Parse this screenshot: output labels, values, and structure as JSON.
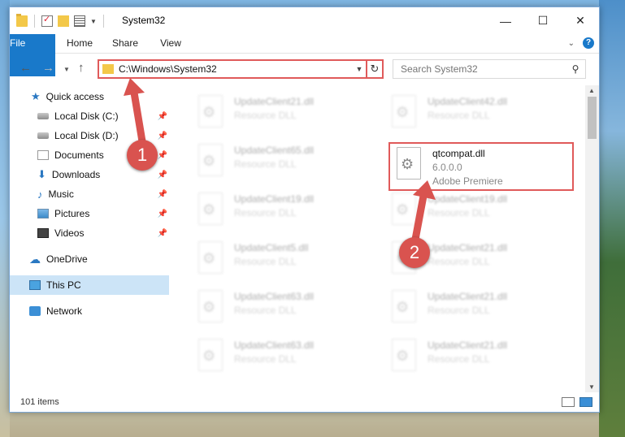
{
  "window": {
    "title": "System32",
    "controls": {
      "minimize": "—",
      "maximize": "☐",
      "close": "✕"
    }
  },
  "ribbon": {
    "tabs": [
      "File",
      "Home",
      "Share",
      "View"
    ]
  },
  "address": {
    "path": "C:\\Windows\\System32",
    "search_placeholder": "Search System32"
  },
  "nav": {
    "items": [
      {
        "label": "Quick access",
        "icon": "star-icon"
      },
      {
        "label": "Local Disk (C:)",
        "icon": "drive-icon",
        "pinned": true
      },
      {
        "label": "Local Disk (D:)",
        "icon": "drive-icon",
        "pinned": true
      },
      {
        "label": "Documents",
        "icon": "documents-icon",
        "pinned": true
      },
      {
        "label": "Downloads",
        "icon": "download-icon",
        "pinned": true
      },
      {
        "label": "Music",
        "icon": "music-icon",
        "pinned": true
      },
      {
        "label": "Pictures",
        "icon": "pictures-icon",
        "pinned": true
      },
      {
        "label": "Videos",
        "icon": "videos-icon",
        "pinned": true
      },
      {
        "label": "OneDrive",
        "icon": "cloud-icon"
      },
      {
        "label": "This PC",
        "icon": "pc-icon",
        "selected": true
      },
      {
        "label": "Network",
        "icon": "network-icon"
      }
    ]
  },
  "files": {
    "highlighted": {
      "name": "qtcompat.dll",
      "version": "6.0.0.0",
      "company": "Adobe Premiere"
    },
    "background": [
      {
        "name": "UpdateClient21.dll",
        "sub": "Resource DLL"
      },
      {
        "name": "UpdateClient42.dll",
        "sub": "Resource DLL"
      },
      {
        "name": "UpdateClient65.dll",
        "sub": "Resource DLL"
      },
      {
        "name": "UpdateClient19.dll",
        "sub": "Resource DLL"
      },
      {
        "name": "UpdateClient19.dll",
        "sub": "Resource DLL"
      },
      {
        "name": "UpdateClient5.dll",
        "sub": "Resource DLL"
      },
      {
        "name": "UpdateClient21.dll",
        "sub": "Resource DLL"
      },
      {
        "name": "UpdateClient63.dll",
        "sub": "Resource DLL"
      },
      {
        "name": "UpdateClient21.dll",
        "sub": "Resource DLL"
      },
      {
        "name": "UpdateClient63.dll",
        "sub": "Resource DLL"
      },
      {
        "name": "UpdateClient21.dll",
        "sub": "Resource DLL"
      }
    ]
  },
  "status": {
    "item_count": "101 items"
  },
  "annotations": {
    "step1": "1",
    "step2": "2",
    "color": "#d9534f"
  }
}
